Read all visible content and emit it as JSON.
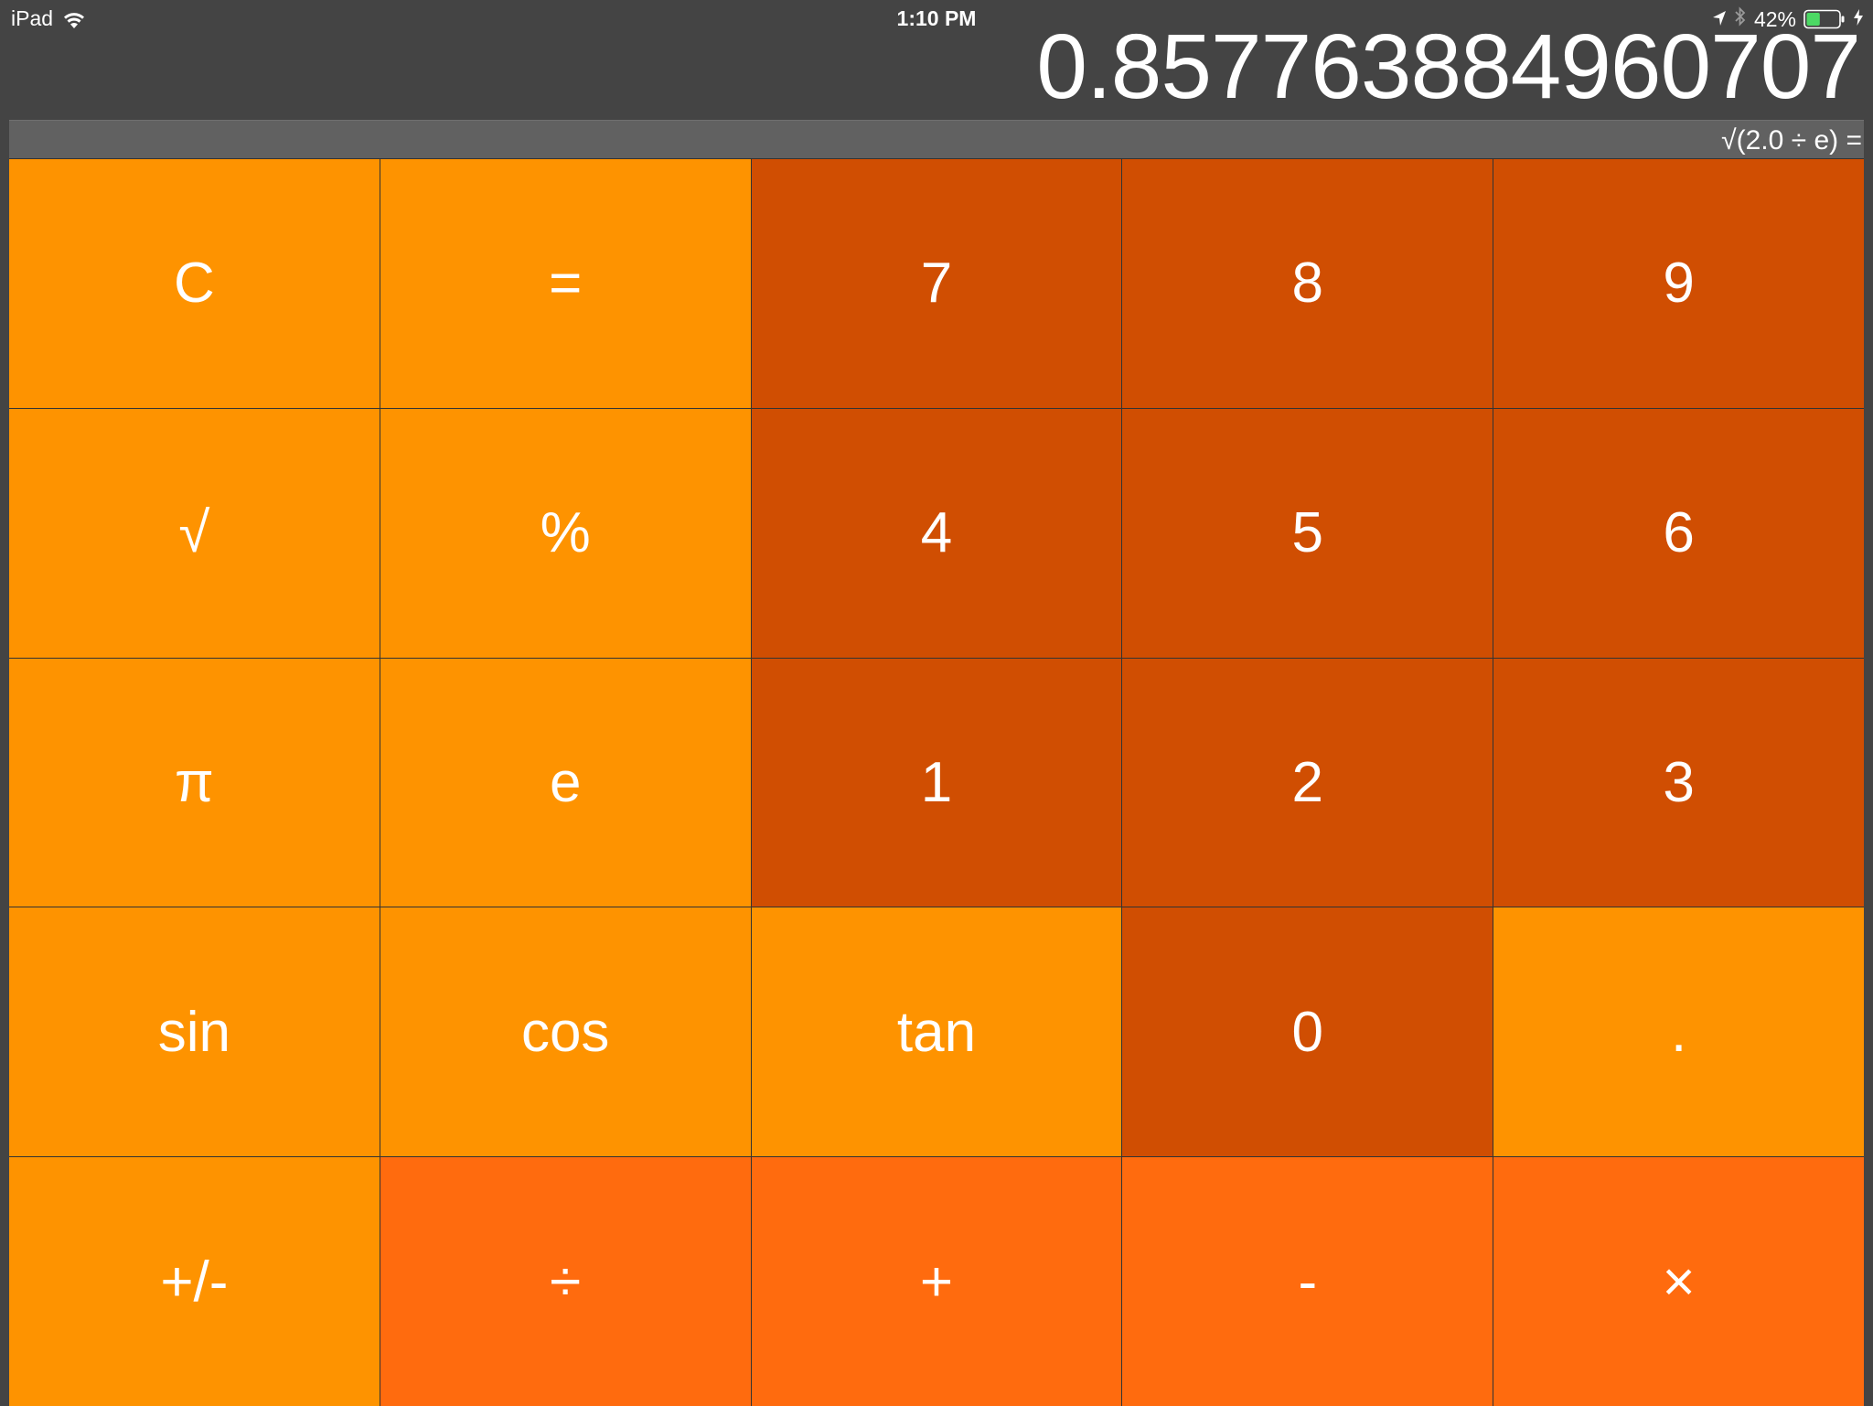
{
  "status_bar": {
    "device": "iPad",
    "time": "1:10 PM",
    "battery_percent": "42%",
    "battery_level": 0.42,
    "icons": [
      "wifi-icon",
      "location-arrow-icon",
      "bluetooth-icon",
      "battery-icon",
      "charging-bolt-icon"
    ]
  },
  "display": {
    "value": "0.857763884960707",
    "expression": "√(2.0 ÷ e) ="
  },
  "keys": [
    {
      "label": "C",
      "type": "func",
      "name": "clear-button"
    },
    {
      "label": "=",
      "type": "func",
      "name": "equals-button"
    },
    {
      "label": "7",
      "type": "num",
      "name": "digit-7-button"
    },
    {
      "label": "8",
      "type": "num",
      "name": "digit-8-button"
    },
    {
      "label": "9",
      "type": "num",
      "name": "digit-9-button"
    },
    {
      "label": "√",
      "type": "func",
      "name": "sqrt-button"
    },
    {
      "label": "%",
      "type": "func",
      "name": "percent-button"
    },
    {
      "label": "4",
      "type": "num",
      "name": "digit-4-button"
    },
    {
      "label": "5",
      "type": "num",
      "name": "digit-5-button"
    },
    {
      "label": "6",
      "type": "num",
      "name": "digit-6-button"
    },
    {
      "label": "π",
      "type": "func",
      "name": "pi-button"
    },
    {
      "label": "e",
      "type": "func",
      "name": "euler-button"
    },
    {
      "label": "1",
      "type": "num",
      "name": "digit-1-button"
    },
    {
      "label": "2",
      "type": "num",
      "name": "digit-2-button"
    },
    {
      "label": "3",
      "type": "num",
      "name": "digit-3-button"
    },
    {
      "label": "sin",
      "type": "func",
      "name": "sin-button"
    },
    {
      "label": "cos",
      "type": "func",
      "name": "cos-button"
    },
    {
      "label": "tan",
      "type": "func",
      "name": "tan-button"
    },
    {
      "label": "0",
      "type": "num",
      "name": "digit-0-button"
    },
    {
      "label": ".",
      "type": "func",
      "name": "decimal-button"
    },
    {
      "label": "+/-",
      "type": "func",
      "name": "negate-button"
    },
    {
      "label": "÷",
      "type": "op",
      "name": "divide-button"
    },
    {
      "label": "+",
      "type": "op",
      "name": "add-button"
    },
    {
      "label": "-",
      "type": "op",
      "name": "subtract-button"
    },
    {
      "label": "×",
      "type": "op",
      "name": "multiply-button"
    }
  ],
  "colors": {
    "background": "#444444",
    "expression_bar": "#616161",
    "function_key": "#fe9300",
    "number_key": "#d04e02",
    "operator_key": "#ff6b0e",
    "battery_fill": "#4cd964"
  }
}
